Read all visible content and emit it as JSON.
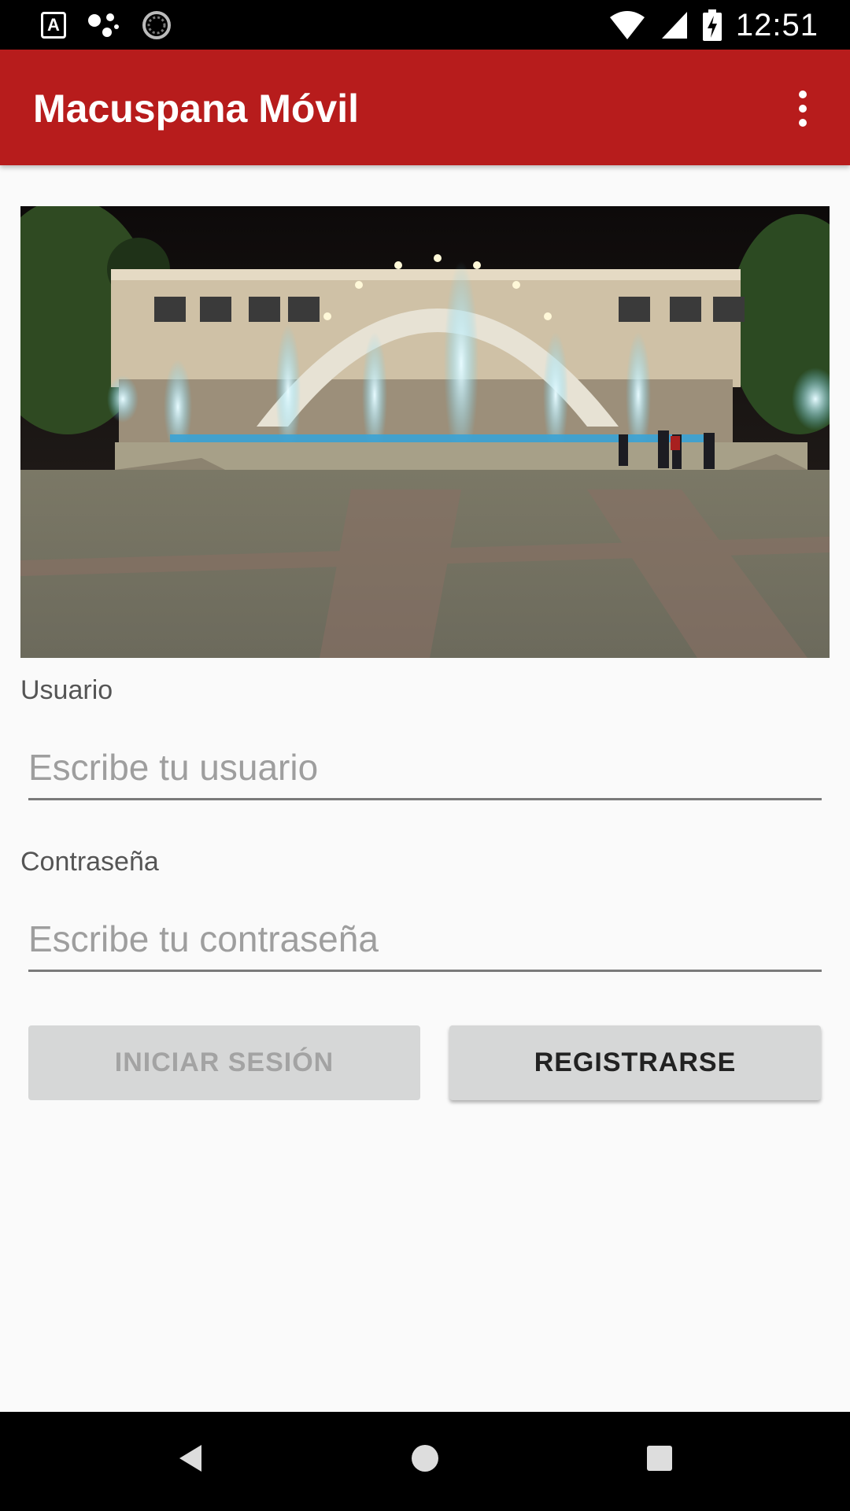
{
  "status_bar": {
    "time": "12:51",
    "a_icon_letter": "A",
    "icons": [
      "a-icon",
      "assistant-icon",
      "sync-icon",
      "wifi-icon",
      "signal-icon",
      "battery-charging-icon"
    ]
  },
  "app_bar": {
    "title": "Macuspana Móvil",
    "color": "#b71c1c",
    "overflow_icon": "more-vert-icon"
  },
  "form": {
    "user_label": "Usuario",
    "user_placeholder": "Escribe tu usuario",
    "user_value": "",
    "password_label": "Contraseña",
    "password_placeholder": "Escribe tu contraseña",
    "password_value": ""
  },
  "buttons": {
    "login_label": "INICIAR SESIÓN",
    "login_enabled": false,
    "register_label": "REGISTRARSE"
  },
  "nav_bar": {
    "icons": [
      "back-icon",
      "home-icon",
      "recents-icon"
    ]
  }
}
